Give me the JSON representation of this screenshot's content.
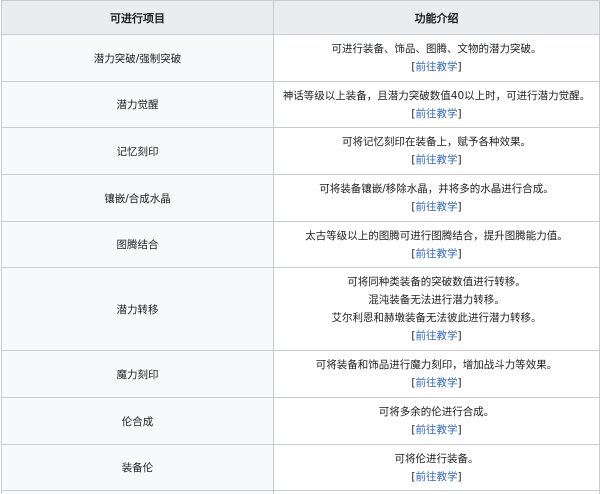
{
  "header": {
    "col1": "可进行项目",
    "col2": "功能介绍"
  },
  "tutorial_label": "前往教学",
  "link_color": "#3366cc",
  "rows": [
    {
      "feature": "潜力突破/强制突破",
      "lines": [
        "可进行装备、饰品、图腾、文物的潜力突破。"
      ]
    },
    {
      "feature": "潜力觉醒",
      "lines": [
        "神话等级以上装备，且潜力突破数值40以上时，可进行潜力觉醒。"
      ]
    },
    {
      "feature": "记忆刻印",
      "lines": [
        "可将记忆刻印在装备上，赋予各种效果。"
      ]
    },
    {
      "feature": "镶嵌/合成水晶",
      "lines": [
        "可将装备镶嵌/移除水晶，并将多的水晶进行合成。"
      ]
    },
    {
      "feature": "图腾结合",
      "lines": [
        "太古等级以上的图腾可进行图腾结合，提升图腾能力值。"
      ]
    },
    {
      "feature": "潜力转移",
      "lines": [
        "可将同种类装备的突破数值进行转移。",
        "混沌装备无法进行潜力转移。",
        "艾尔利恩和赫墩装备无法彼此进行潜力转移。"
      ]
    },
    {
      "feature": "魔力刻印",
      "lines": [
        "可将装备和饰品进行魔力刻印，增加战斗力等效果。"
      ]
    },
    {
      "feature": "伦合成",
      "lines": [
        "可将多余的伦进行合成。"
      ]
    },
    {
      "feature": "装备伦",
      "lines": [
        "可将伦进行装备。"
      ]
    }
  ]
}
